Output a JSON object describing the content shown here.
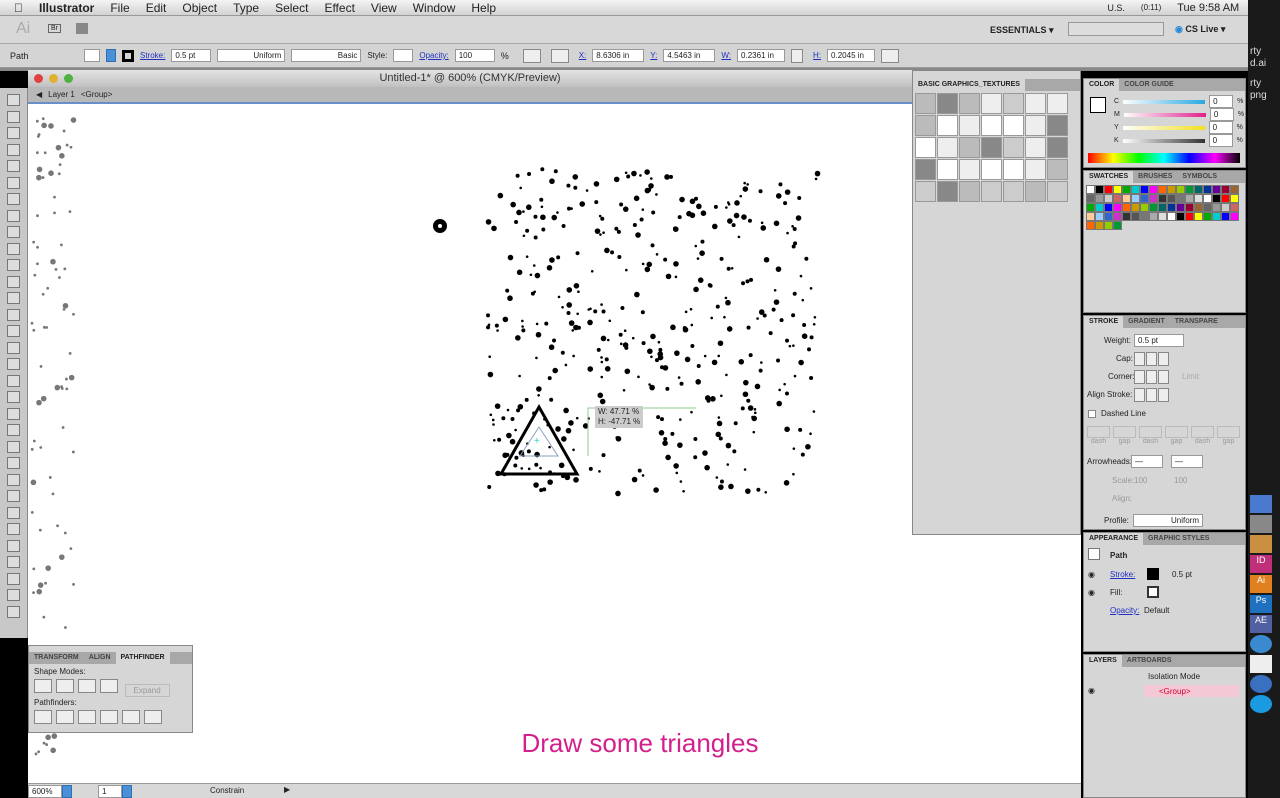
{
  "menubar": {
    "app": "Illustrator",
    "items": [
      "File",
      "Edit",
      "Object",
      "Type",
      "Select",
      "Effect",
      "View",
      "Window",
      "Help"
    ],
    "locale": "U.S.",
    "battery": "(0:11)",
    "clock": "Tue 9:58 AM"
  },
  "appbar": {
    "logo": "Ai",
    "bridge": "Br",
    "workspace": "ESSENTIALS ▾",
    "cslive": "CS Live ▾"
  },
  "control": {
    "selection": "Path",
    "stroke_label": "Stroke:",
    "stroke_value": "0.5 pt",
    "profile": "Uniform",
    "brush": "Basic",
    "style_label": "Style:",
    "opacity_label": "Opacity:",
    "opacity_value": "100",
    "pct": "%",
    "x_label": "X:",
    "x": "8.6306 in",
    "y_label": "Y:",
    "y": "4.5463 in",
    "w_label": "W:",
    "w": "0.2361 in",
    "h_label": "H:",
    "h": "0.2045 in"
  },
  "document": {
    "title": "Untitled-1* @ 600% (CMYK/Preview)",
    "layer": "Layer 1",
    "group": "<Group>"
  },
  "tooltip": {
    "w": "W: 47.71 %",
    "h": "H: -47.71 %"
  },
  "status": {
    "zoom": "600%",
    "page": "1",
    "mode": "Constrain"
  },
  "pathfinder": {
    "tabs": [
      "TRANSFORM",
      "ALIGN",
      "PATHFINDER"
    ],
    "shape_modes": "Shape Modes:",
    "expand": "Expand",
    "pathfinders": "Pathfinders:"
  },
  "textures": {
    "title": "BASIC GRAPHICS_TEXTURES"
  },
  "color": {
    "tabs": [
      "COLOR",
      "COLOR GUIDE"
    ],
    "channels": [
      {
        "l": "C",
        "v": "0",
        "c": "#29a8e0"
      },
      {
        "l": "M",
        "v": "0",
        "c": "#e0208c"
      },
      {
        "l": "Y",
        "v": "0",
        "c": "#f0e020"
      },
      {
        "l": "K",
        "v": "0",
        "c": "#333333"
      }
    ],
    "pct": "%"
  },
  "swatches": {
    "tabs": [
      "SWATCHES",
      "BRUSHES",
      "SYMBOLS"
    ]
  },
  "stroke": {
    "tabs": [
      "STROKE",
      "GRADIENT",
      "TRANSPARE"
    ],
    "weight_label": "Weight:",
    "weight": "0.5 pt",
    "cap": "Cap:",
    "corner": "Corner:",
    "limit": "Limit:",
    "align": "Align Stroke:",
    "dashed": "Dashed Line",
    "dash_labels": [
      "dash",
      "gap",
      "dash",
      "gap",
      "dash",
      "gap"
    ],
    "arrowheads": "Arrowheads:",
    "scale": "Scale:",
    "scale1": "100",
    "scale2": "100",
    "align2": "Align:",
    "profile_label": "Profile:",
    "profile": "Uniform"
  },
  "appearance": {
    "tabs": [
      "APPEARANCE",
      "GRAPHIC STYLES"
    ],
    "title": "Path",
    "stroke": "Stroke:",
    "stroke_val": "0.5 pt",
    "fill": "Fill:",
    "opacity": "Opacity:",
    "opacity_val": "Default"
  },
  "layers": {
    "tabs": [
      "LAYERS",
      "ARTBOARDS"
    ],
    "isolation": "Isolation Mode",
    "group": "<Group>"
  },
  "dock_text": [
    "rty",
    "d.ai",
    "rty",
    "png"
  ],
  "caption": "Draw some triangles"
}
